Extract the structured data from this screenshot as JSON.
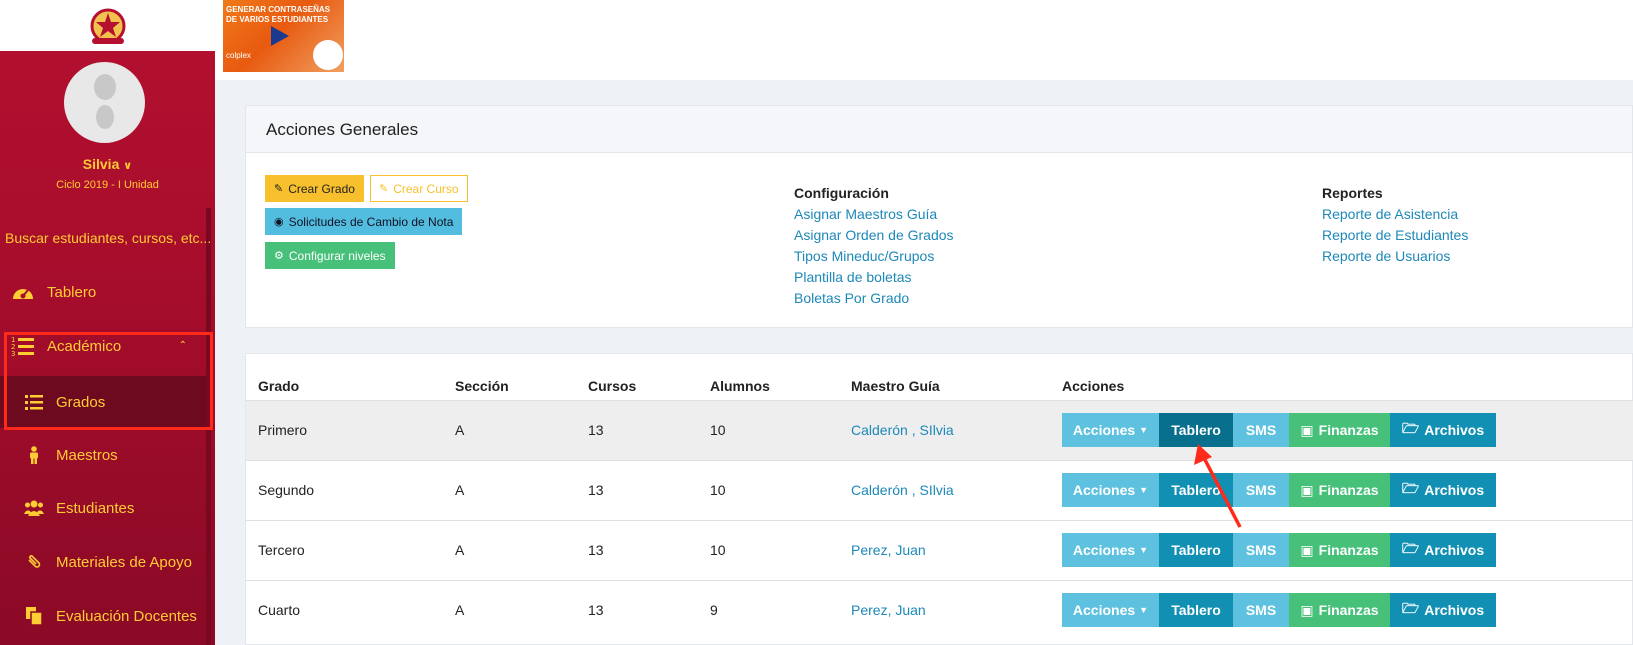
{
  "sidebar": {
    "user_name": "Silvia",
    "user_chevron": "⌄",
    "cycle": "Ciclo 2019 - I Unidad",
    "search_placeholder": "Buscar estudiantes, cursos, etc...",
    "items": [
      {
        "label": "Tablero",
        "icon": "dashboard-icon"
      },
      {
        "label": "Académico",
        "icon": "list-numbered-icon"
      },
      {
        "label": "Grados",
        "icon": "list-icon"
      },
      {
        "label": "Maestros",
        "icon": "person-icon"
      },
      {
        "label": "Estudiantes",
        "icon": "users-icon"
      },
      {
        "label": "Materiales de Apoyo",
        "icon": "paperclip-icon"
      },
      {
        "label": "Evaluación Docentes",
        "icon": "copy-icon"
      }
    ],
    "accent_color": "#ffcc33"
  },
  "video_thumb": {
    "title_line1": "GENERAR CONTRASEÑAS",
    "title_line2": "DE VARIOS ESTUDIANTES",
    "brand": "colplex"
  },
  "panel": {
    "title": "Acciones Generales",
    "buttons": {
      "crear_grado": "Crear Grado",
      "crear_curso": "Crear Curso",
      "solicitudes": "Solicitudes de Cambio de Nota",
      "configurar": "Configurar niveles"
    },
    "config": {
      "title": "Configuración",
      "links": [
        "Asignar Maestros Guía",
        "Asignar Orden de Grados",
        "Tipos Mineduc/Grupos",
        "Plantilla de boletas",
        "Boletas Por Grado"
      ]
    },
    "reports": {
      "title": "Reportes",
      "links": [
        "Reporte de Asistencia",
        "Reporte de Estudiantes",
        "Reporte de Usuarios"
      ]
    }
  },
  "table": {
    "headers": [
      "Grado",
      "Sección",
      "Cursos",
      "Alumnos",
      "Maestro Guía",
      "Acciones"
    ],
    "rows": [
      {
        "grado": "Primero",
        "seccion": "A",
        "cursos": "13",
        "alumnos": "10",
        "maestro": "Calderón , SIlvia"
      },
      {
        "grado": "Segundo",
        "seccion": "A",
        "cursos": "13",
        "alumnos": "10",
        "maestro": "Calderón , SIlvia"
      },
      {
        "grado": "Tercero",
        "seccion": "A",
        "cursos": "13",
        "alumnos": "10",
        "maestro": "Perez, Juan"
      },
      {
        "grado": "Cuarto",
        "seccion": "A",
        "cursos": "13",
        "alumnos": "9",
        "maestro": "Perez, Juan"
      }
    ],
    "action_labels": {
      "acciones": "Acciones",
      "tablero": "Tablero",
      "sms": "SMS",
      "finanzas": "Finanzas",
      "archivos": "Archivos"
    }
  }
}
